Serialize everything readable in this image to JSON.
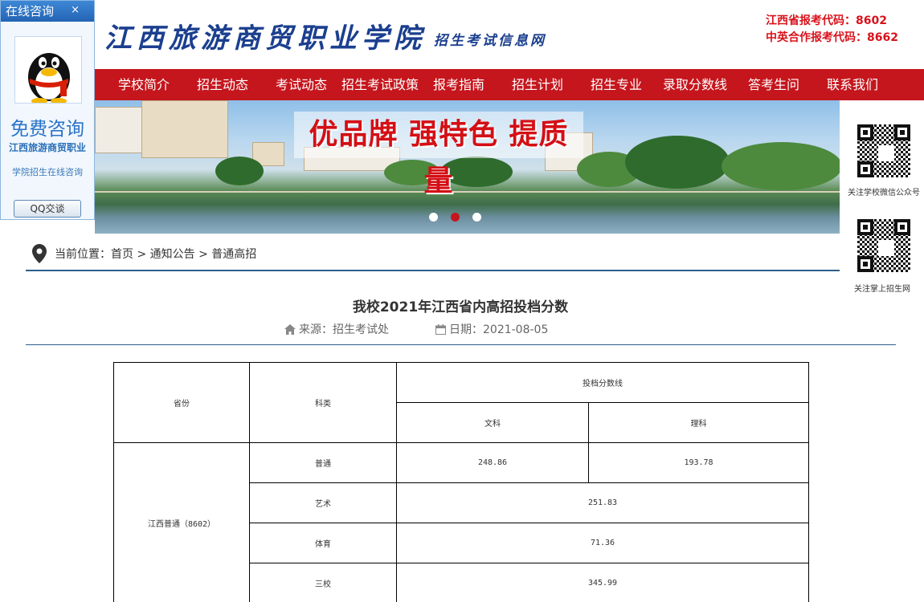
{
  "header": {
    "title": "江西旅游商贸职业学院",
    "subtitle": "招生考试信息网",
    "codes": [
      "江西省报考代码：8602",
      "中英合作报考代码：8662"
    ]
  },
  "nav": {
    "items": [
      "学校简介",
      "招生动态",
      "考试动态",
      "招生考试政策",
      "报考指南",
      "招生计划",
      "招生专业",
      "录取分数线",
      "答考生问",
      "联系我们"
    ]
  },
  "banner": {
    "slogan": "优品牌 强特色 提质量",
    "slides": 3,
    "active_slide": 2
  },
  "qq_panel": {
    "title": "在线咨询",
    "close": "×",
    "free": "免费咨询",
    "line1": "江西旅游商贸职业",
    "line2": "学院招生在线咨询",
    "button": "QQ交谈"
  },
  "qr": {
    "wechat_caption": "关注学校微信公众号",
    "mobile_caption": "关注掌上招生网"
  },
  "breadcrumb": {
    "text": "当前位置：首页 > 通知公告 > 普通高招"
  },
  "article": {
    "title": "我校2021年江西省内高招投档分数",
    "source": "来源：招生考试处",
    "date": "日期：2021-08-05"
  },
  "table": {
    "h_province": "省份",
    "h_category": "科类",
    "h_score": "投档分数线",
    "h_arts": "文科",
    "h_science": "理科",
    "province": "江西普通（8602）",
    "rows": [
      {
        "category": "普通",
        "arts": "248.86",
        "science": "193.78"
      },
      {
        "category": "艺术",
        "merged": "251.83"
      },
      {
        "category": "体育",
        "merged": "71.36"
      },
      {
        "category": "三校",
        "merged": "345.99"
      }
    ]
  },
  "colors": {
    "brand_red": "#c5161d",
    "brand_blue": "#1b3f8f",
    "code_red": "#d8121b",
    "rule_blue": "#2b5f8c"
  }
}
